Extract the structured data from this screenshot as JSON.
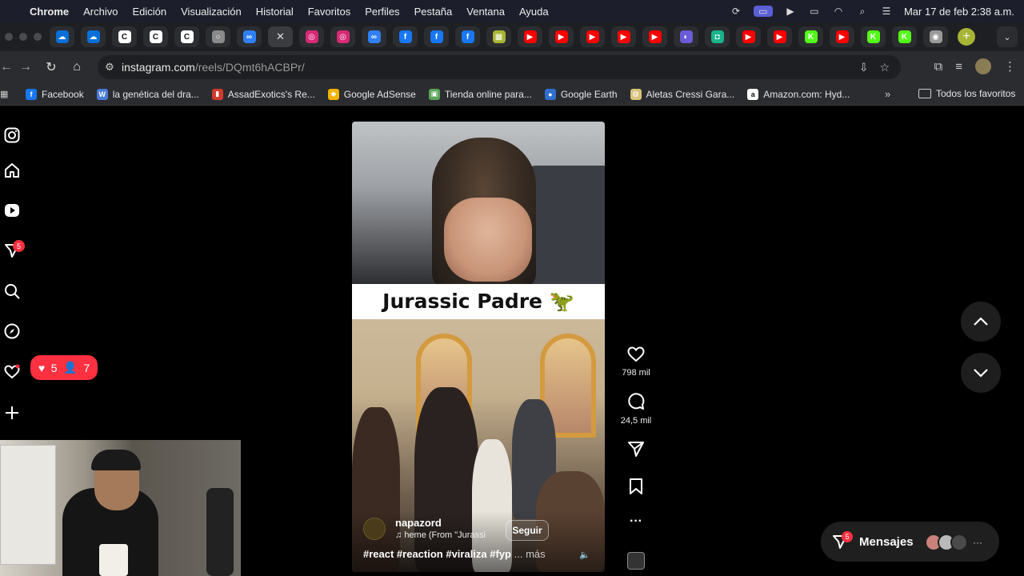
{
  "menubar": {
    "app": "Chrome",
    "items": [
      "Archivo",
      "Edición",
      "Visualización",
      "Historial",
      "Favoritos",
      "Perfiles",
      "Pestaña",
      "Ventana",
      "Ayuda"
    ],
    "clock": "Mar 17 de feb  2:38 a.m."
  },
  "tabs": [
    {
      "icon": "onedrive-icon",
      "color": "#0a6fd8",
      "glyph": "☁"
    },
    {
      "icon": "onedrive-icon",
      "color": "#0a6fd8",
      "glyph": "☁"
    },
    {
      "icon": "capcut-icon",
      "color": "#ffffff",
      "glyph": "C"
    },
    {
      "icon": "capcut-icon",
      "color": "#ffffff",
      "glyph": "C"
    },
    {
      "icon": "capcut-icon",
      "color": "#ffffff",
      "glyph": "C"
    },
    {
      "icon": "generic-tab-icon",
      "color": "#8a8a8a",
      "glyph": "○"
    },
    {
      "icon": "meta-icon",
      "color": "#2f7ff5",
      "glyph": "∞"
    },
    {
      "icon": "close-icon",
      "active": true
    },
    {
      "icon": "instagram-icon",
      "color": "#d62976",
      "glyph": "◎"
    },
    {
      "icon": "instagram-icon",
      "color": "#d62976",
      "glyph": "◎"
    },
    {
      "icon": "meta-icon",
      "color": "#2f7ff5",
      "glyph": "∞"
    },
    {
      "icon": "facebook-icon",
      "color": "#1877f2",
      "glyph": "f"
    },
    {
      "icon": "facebook-icon",
      "color": "#1877f2",
      "glyph": "f"
    },
    {
      "icon": "facebook-icon",
      "color": "#1877f2",
      "glyph": "f"
    },
    {
      "icon": "sheets-icon",
      "color": "#a8b534",
      "glyph": "▦"
    },
    {
      "icon": "youtube-icon",
      "color": "#ff0000",
      "glyph": "▶"
    },
    {
      "icon": "youtube-icon",
      "color": "#ff0000",
      "glyph": "▶"
    },
    {
      "icon": "youtube-icon",
      "color": "#ff0000",
      "glyph": "▶"
    },
    {
      "icon": "youtube-icon",
      "color": "#ff0000",
      "glyph": "▶"
    },
    {
      "icon": "youtube-icon",
      "color": "#ff0000",
      "glyph": "▶"
    },
    {
      "icon": "app-icon",
      "color": "#6b5bd6",
      "glyph": "◐"
    },
    {
      "icon": "app-icon",
      "color": "#18b38a",
      "glyph": "◘"
    },
    {
      "icon": "youtube-icon",
      "color": "#ff0000",
      "glyph": "▶"
    },
    {
      "icon": "youtube-icon",
      "color": "#ff0000",
      "glyph": "▶"
    },
    {
      "icon": "kick-icon",
      "color": "#53fc18",
      "glyph": "K"
    },
    {
      "icon": "youtube-icon",
      "color": "#ff0000",
      "glyph": "▶"
    },
    {
      "icon": "kick-icon",
      "color": "#53fc18",
      "glyph": "K"
    },
    {
      "icon": "kick-icon",
      "color": "#53fc18",
      "glyph": "K"
    },
    {
      "icon": "chrome-icon",
      "color": "#9a9a9a",
      "glyph": "◉"
    }
  ],
  "toolbar": {
    "url_host": "instagram.com",
    "url_path": "/reels/DQmt6hACBPr/"
  },
  "bookmarks": [
    {
      "label": "Facebook",
      "icon": "facebook-icon",
      "color": "#1877f2",
      "glyph": "f"
    },
    {
      "label": "la genética del dra...",
      "icon": "wix-icon",
      "color": "#4a7bd6",
      "glyph": "W"
    },
    {
      "label": "AssadExotics's Re...",
      "icon": "chart-icon",
      "color": "#d23a2e",
      "glyph": "▮"
    },
    {
      "label": "Google AdSense",
      "icon": "adsense-icon",
      "color": "#f4b400",
      "glyph": "◆"
    },
    {
      "label": "Tienda online para...",
      "icon": "store-icon",
      "color": "#5aa55a",
      "glyph": "▣"
    },
    {
      "label": "Google Earth",
      "icon": "earth-icon",
      "color": "#2f6fd0",
      "glyph": "●"
    },
    {
      "label": "Aletas Cressi Gara...",
      "icon": "ml-icon",
      "color": "#d8c27a",
      "glyph": "◍"
    },
    {
      "label": "Amazon.com: Hyd...",
      "icon": "amazon-icon",
      "color": "#ffffff",
      "glyph": "a"
    }
  ],
  "bookmarks_folder": "Todos los favoritos",
  "sidebar": {
    "notifications_badge": "5"
  },
  "notif_pill": {
    "likes": "5",
    "follows": "7"
  },
  "reel": {
    "caption": "Jurassic Padre 🦖",
    "author": "napazord",
    "audio": "heme (From \"Jurassi",
    "follow": "Seguir",
    "hashtags": "#react #reaction #viraliza #fyp",
    "more": "... más",
    "likes": "798 mil",
    "comments": "24,5 mil"
  },
  "messages": {
    "label": "Mensajes",
    "badge": "5"
  }
}
